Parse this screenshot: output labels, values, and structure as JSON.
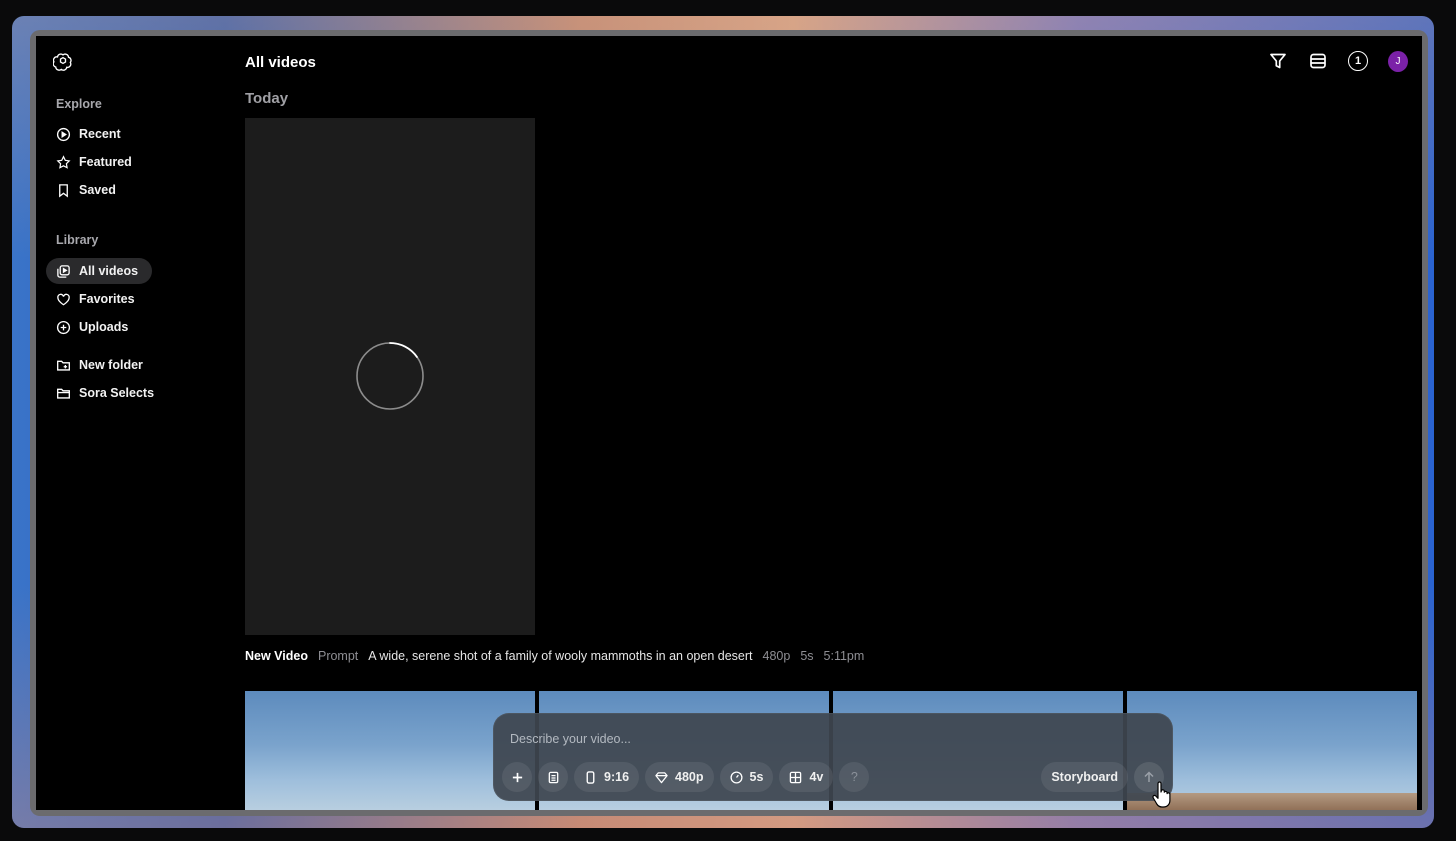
{
  "header": {
    "title": "All videos"
  },
  "sidebar": {
    "explore_title": "Explore",
    "explore_items": [
      {
        "label": "Recent",
        "icon": "play-circle-icon"
      },
      {
        "label": "Featured",
        "icon": "star-icon"
      },
      {
        "label": "Saved",
        "icon": "bookmark-icon"
      }
    ],
    "library_title": "Library",
    "library_items": [
      {
        "label": "All videos",
        "icon": "videos-icon",
        "active": true
      },
      {
        "label": "Favorites",
        "icon": "heart-icon"
      },
      {
        "label": "Uploads",
        "icon": "plus-circle-icon"
      }
    ],
    "folders": [
      {
        "label": "New folder",
        "icon": "folder-plus-icon"
      },
      {
        "label": "Sora Selects",
        "icon": "folder-icon"
      }
    ]
  },
  "topbar": {
    "notification_count": "1",
    "avatar_initial": "J",
    "avatar_color": "#7b21a8"
  },
  "feed": {
    "date_label": "Today",
    "video": {
      "title": "New Video",
      "prompt_label": "Prompt",
      "prompt": "A wide, serene shot of a family of wooly mammoths in an open desert",
      "resolution": "480p",
      "duration": "5s",
      "time": "5:11pm"
    }
  },
  "composer": {
    "placeholder": "Describe your video...",
    "aspect_ratio": "9:16",
    "resolution": "480p",
    "duration": "5s",
    "variations": "4v",
    "help": "?",
    "storyboard_label": "Storyboard"
  }
}
